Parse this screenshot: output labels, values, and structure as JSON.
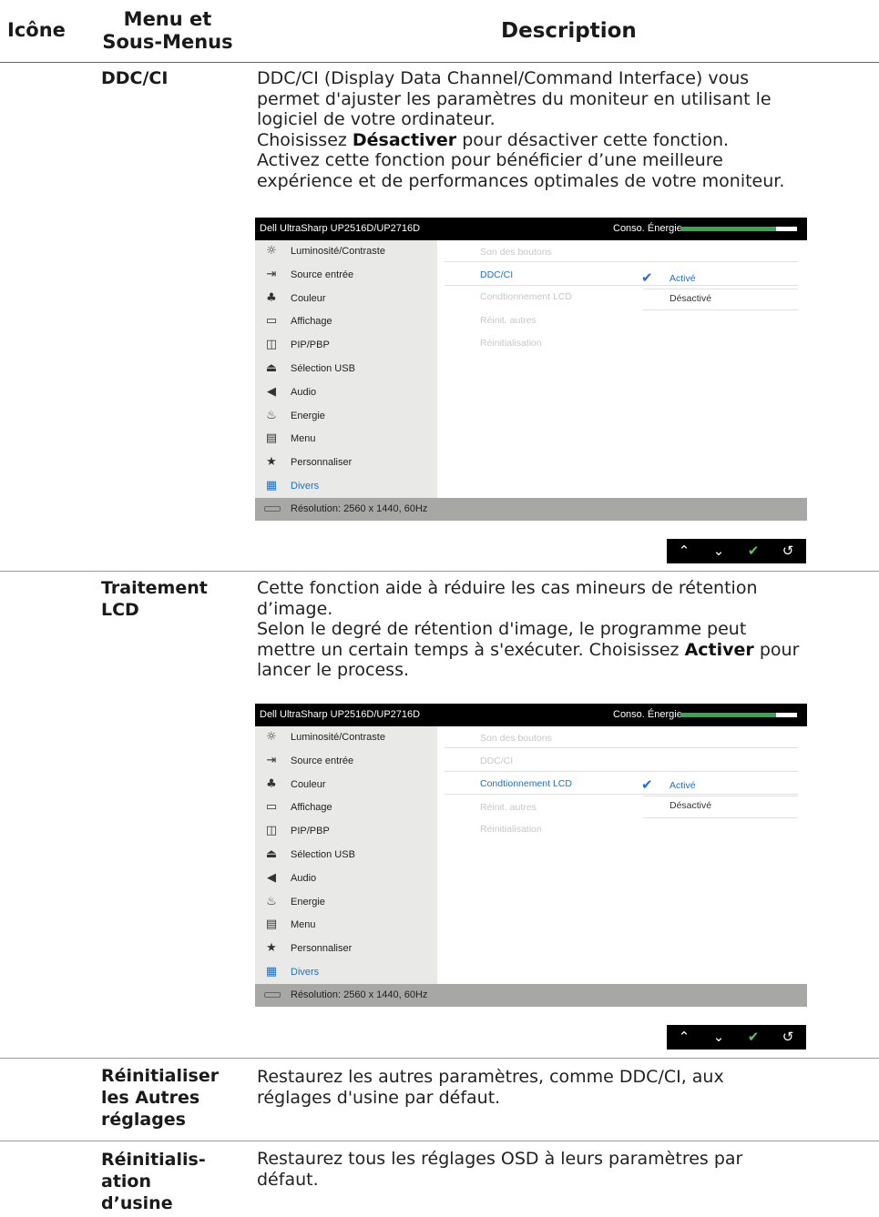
{
  "header": {
    "col1": "Icône",
    "col2_line1": "Menu et",
    "col2_line2": "Sous-Menus",
    "col3": "Description"
  },
  "rows": {
    "ddcci": {
      "name": "DDC/CI",
      "d1": "DDC/CI (Display Data Channel/Command Interface) vous",
      "d2": "permet d'ajuster les paramètres du moniteur en utilisant le",
      "d3": "logiciel de votre ordinateur.",
      "d4a": "Choisissez ",
      "d4b": "Désactiver",
      "d4c": " pour désactiver cette fonction.",
      "d5": "Activez cette fonction pour bénéficier d’une meilleure",
      "d6": "expérience et de performances optimales de votre moniteur."
    },
    "lcd": {
      "name1": "Traitement",
      "name2": "LCD",
      "d1": "Cette fonction aide à réduire les cas mineurs de rétention",
      "d2": "d’image.",
      "d3": "Selon le degré de rétention d'image, le programme peut",
      "d4a": "mettre un certain temps à s'exécuter. Choisissez ",
      "d4b": "Activer",
      "d4c": " pour",
      "d5": "lancer le process."
    },
    "reset_other": {
      "name1": "Réinitialiser",
      "name2": "les Autres",
      "name3": "réglages",
      "d1": "Restaurez les autres paramètres, comme DDC/CI, aux",
      "d2": "réglages d'usine par défaut."
    },
    "factory": {
      "name1": "Réinitialis-",
      "name2": "ation",
      "name3": "d’usine",
      "d1": "Restaurez tous les réglages OSD à leurs paramètres par",
      "d2": "défaut."
    }
  },
  "osd": {
    "title": "Dell UltraSharp UP2516D/UP2716D",
    "energy_label": "Conso. Énergie",
    "energy_level": 0.82,
    "menu": [
      {
        "icon": "brightness-icon",
        "glyph": "☼",
        "label": "Luminosité/Contraste"
      },
      {
        "icon": "input-source-icon",
        "glyph": "⇥",
        "label": "Source entrée"
      },
      {
        "icon": "color-icon",
        "glyph": "♣",
        "label": "Couleur"
      },
      {
        "icon": "display-icon",
        "glyph": "▭",
        "label": "Affichage"
      },
      {
        "icon": "pip-icon",
        "glyph": "◫",
        "label": "PIP/PBP"
      },
      {
        "icon": "usb-icon",
        "glyph": "⏏",
        "label": "Sélection USB"
      },
      {
        "icon": "audio-icon",
        "glyph": "◀",
        "label": "Audio"
      },
      {
        "icon": "energy-icon",
        "glyph": "♨",
        "label": "Energie"
      },
      {
        "icon": "menu-icon",
        "glyph": "▤",
        "label": "Menu"
      },
      {
        "icon": "star-icon",
        "glyph": "★",
        "label": "Personnaliser"
      },
      {
        "icon": "others-icon",
        "glyph": "▦",
        "label": "Divers"
      }
    ],
    "submenu": [
      "Son des boutons",
      "DDC/CI",
      "Condtionnement LCD",
      "Réinit. autres",
      "Réinitialisation"
    ],
    "opt_on": "Activé",
    "opt_off": "Désactivé",
    "resolution": "Résolution: 2560 x 1440, 60Hz",
    "nav": {
      "up": "⌃",
      "down": "⌄",
      "ok": "✔",
      "back": "↺"
    }
  }
}
